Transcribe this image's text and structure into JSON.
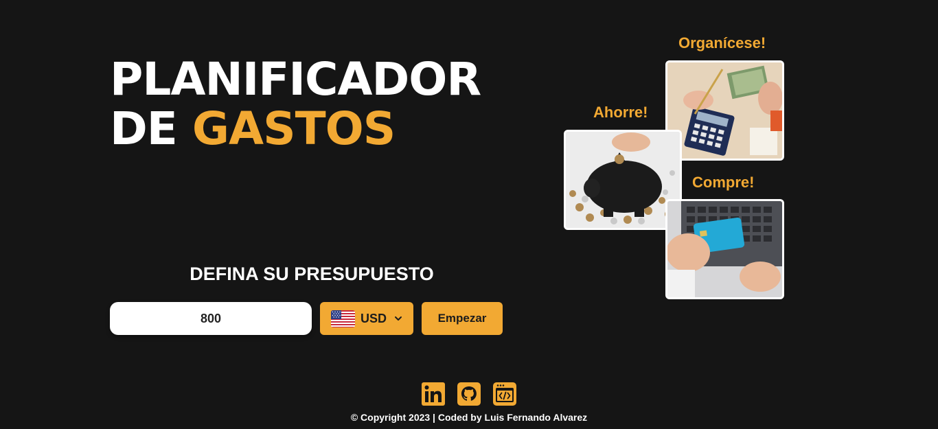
{
  "hero": {
    "title_line1": "PLANIFICADOR",
    "title_line2_white": "DE ",
    "title_line2_accent": "GASTOS"
  },
  "budget": {
    "label": "DEFINA SU PRESUPUESTO",
    "value": "800",
    "currency": "USD",
    "currency_flag_icon": "us-flag-icon",
    "start_label": "Empezar"
  },
  "gallery": {
    "organize": {
      "caption": "Organícese!",
      "icon": "calculator-money-photo"
    },
    "save": {
      "caption": "Ahorre!",
      "icon": "piggy-bank-photo"
    },
    "buy": {
      "caption": "Compre!",
      "icon": "credit-card-laptop-photo"
    }
  },
  "socials": [
    {
      "name": "linkedin-icon"
    },
    {
      "name": "github-icon"
    },
    {
      "name": "code-window-icon"
    }
  ],
  "footer": {
    "copyright": "© Copyright 2023 | Coded by Luis Fernando Alvarez"
  },
  "colors": {
    "background": "#151515",
    "accent": "#f2a933",
    "text": "#ffffff"
  }
}
